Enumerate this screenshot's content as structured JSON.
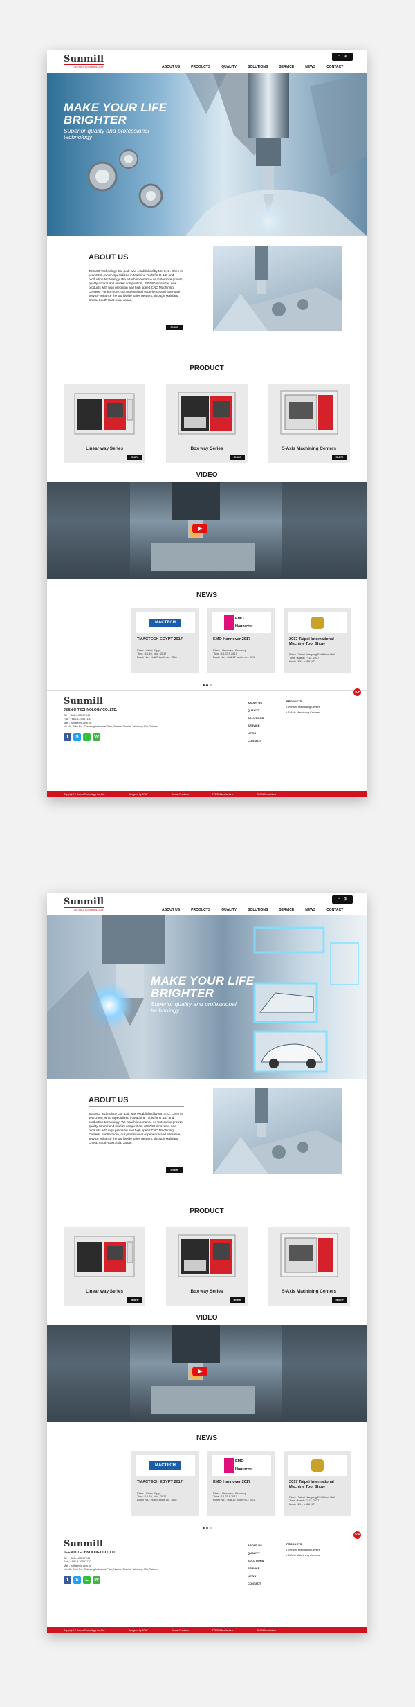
{
  "header": {
    "logo_text": "Sunmill",
    "logo_sub": "JEENIO TECHNOLOGY",
    "nav": [
      "ABOUT US",
      "PRODUCTS",
      "QUALITY",
      "SOLUTIONS",
      "SERVICE",
      "NEWS",
      "CONTACT"
    ],
    "lang_icons": [
      "home-icon",
      "globe-icon"
    ]
  },
  "banner": {
    "headline_1": "MAKE YOUR LIFE",
    "headline_2": "BRIGHTER",
    "sub_1": "Superior quality and professional",
    "sub_2": "technology"
  },
  "about": {
    "title": "ABOUT US",
    "body": "JEENIO Technology Co., Ltd. was established by Mr. S. C. Chen in year 2000, which specialized in Machine Tools for R & D and production technology. We attach importance on Enterprise growth, quality control and market competition, JEENIO innovates new products with high precision and high speed CNC Machining Centers. Furthermore, our professional experience and after-sale service enhance the worldwide sales network: through Mainland China, South-East Asia, Japan,",
    "more": "more"
  },
  "product": {
    "title": "PRODUCT",
    "items": [
      {
        "label": "Linear way Series",
        "more": "more"
      },
      {
        "label": "Box way Series",
        "more": "more"
      },
      {
        "label": "5-Axis Machining Centers",
        "more": "more"
      }
    ]
  },
  "video": {
    "title": "VIDEO"
  },
  "news": {
    "title": "NEWS",
    "items": [
      {
        "logo": "MACTECH",
        "title": "TMACTECH EGYPT 2017",
        "details": "Place : Cairo, Egypt\nTime : 16-19, Nov., 2017\nBooth No. : Hall 5 booth no. : 5A1"
      },
      {
        "logo": "EMO Hannover",
        "title": "EMO Hannover 2017",
        "details": "Place : Hannover, Germany\nTime : 18-23.9.2017\nBooth No. : Hall 12 booth no. : B21"
      },
      {
        "logo": "",
        "title": "2017 Taipei International Machine Tool Show",
        "details": "Place : Taipei Nangang Exhibition Hall\nTime : March 7~12, 2017\nBooth NO. : L618 (4F)"
      }
    ]
  },
  "footer": {
    "logo_text": "Sunmill",
    "company": "JEENIO TECHNOLOGY CO.,LTD.",
    "info": "Tel : +886-4-23597944\nFax : +886-4-23597130\nMail : js@jeenio.com.tw\nNo. 46, 20th Rd., Taichung Industrial Park, Nantun District, Taichung 408, Taiwan.",
    "col1": [
      "ABOUT US",
      "QUALITY",
      "SOLUTIONS",
      "SERVICE",
      "NEWS",
      "CONTACT"
    ],
    "col2_title": "PRODUCTS",
    "col2": [
      "• Vertical Machining Center",
      "• 5-Axis Machining Centers"
    ],
    "top": "TOP",
    "copyright": [
      "Copyright © Jeenio Technology Co.,Ltd.",
      "Designed by DTAT",
      "Taiwan Products",
      "TTBSSManufacturer",
      "TAIWANmachines"
    ]
  },
  "colors": {
    "accent": "#cf1420",
    "dark": "#111111"
  }
}
